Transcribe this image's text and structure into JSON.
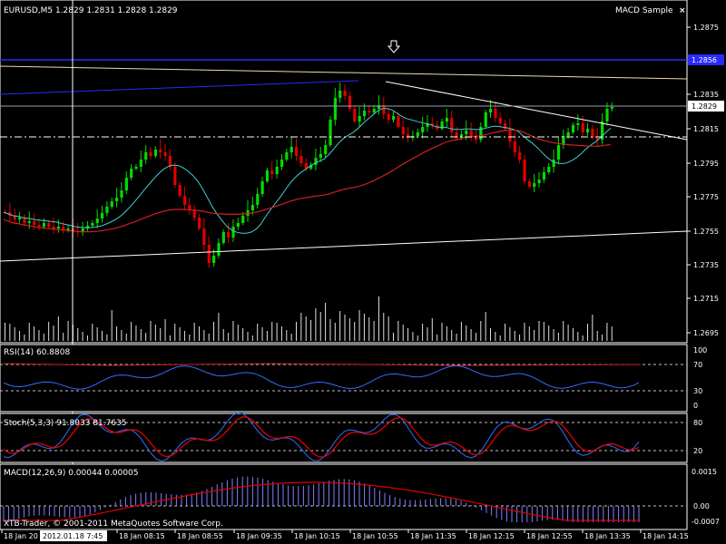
{
  "main": {
    "header": "EURUSD,M5  1.2829 1.2831 1.2828 1.2829",
    "ea_name": "MACD Sample",
    "ea_close_icon": "x-close-icon",
    "arrow_icon": "down-arrow-icon",
    "price_labels": [
      "1.2875",
      "1.2855",
      "1.2835",
      "1.2815",
      "1.2795",
      "1.2775",
      "1.2755",
      "1.2735",
      "1.2715",
      "1.2695"
    ],
    "line_tag": "1.2856",
    "bid_tag": "1.2829",
    "colors": {
      "bull": "#00dc00",
      "bear": "#e00000",
      "ma_fast": "#40d0d0",
      "ma_slow": "#d02020",
      "level": "#2a2aff",
      "trend": "#ffffff",
      "volume": "#ffffff"
    }
  },
  "rsi": {
    "header": "RSI(14) 60.8808",
    "scale": [
      "100",
      "70",
      "30",
      "0"
    ]
  },
  "stoch": {
    "header": "Stoch(5,3,3) 91.8033 81.7635",
    "scale": [
      "80",
      "20"
    ]
  },
  "macd": {
    "header": "MACD(12,26,9) 0.00044 0.00005",
    "scale": [
      "0.0015",
      "0.00",
      "-0.0007"
    ]
  },
  "footer": {
    "copyright": "XTB-Trader, © 2001-2011 MetaQuotes Software Corp.",
    "cursor_time": "2012.01.18 7:45",
    "time_labels": [
      "18 Jan 20",
      "18 Jan 08:15",
      "18 Jan 08:55",
      "18 Jan 09:35",
      "18 Jan 10:15",
      "18 Jan 10:55",
      "18 Jan 11:35",
      "18 Jan 12:15",
      "18 Jan 12:55",
      "18 Jan 13:35",
      "18 Jan 14:15"
    ]
  }
}
